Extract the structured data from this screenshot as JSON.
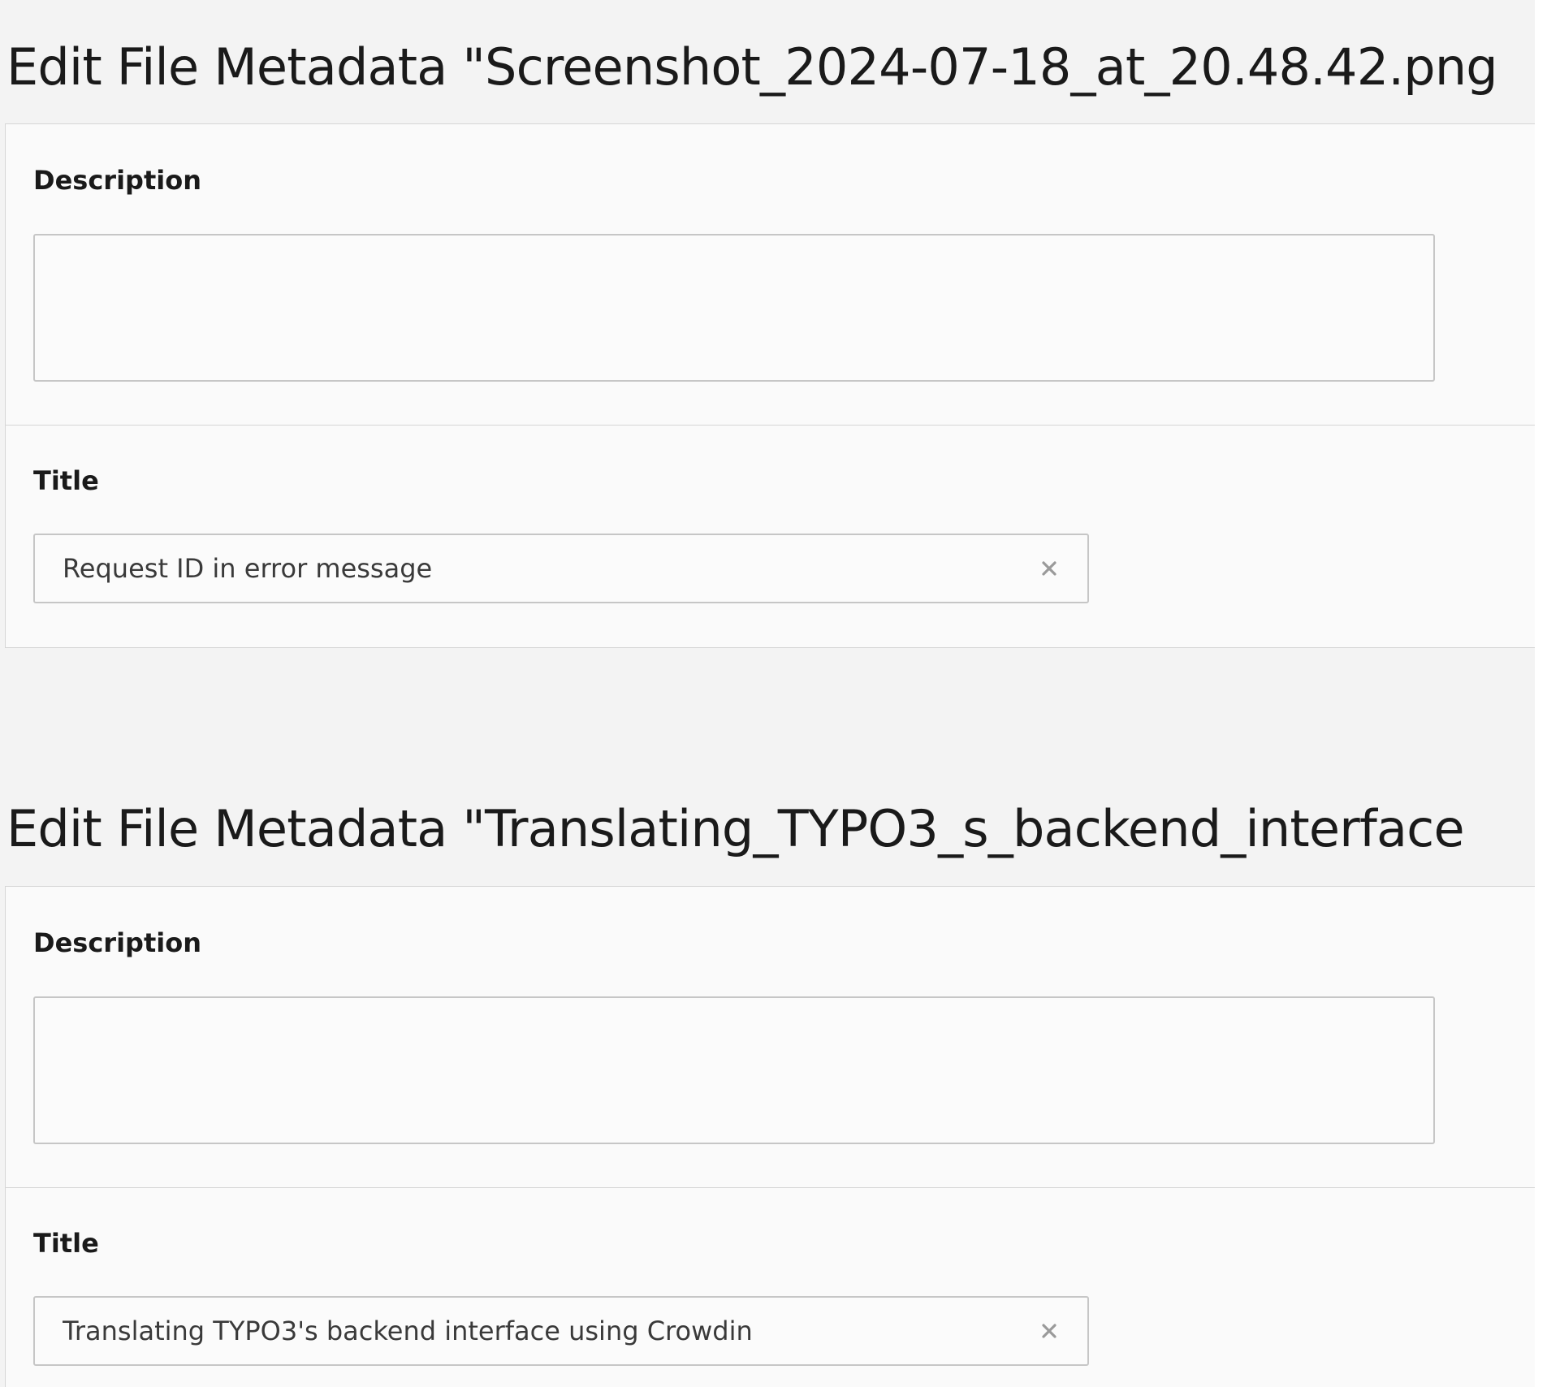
{
  "forms": [
    {
      "heading": "Edit File Metadata \"Screenshot_2024-07-18_at_20.48.42.png",
      "description": {
        "label": "Description",
        "value": ""
      },
      "title": {
        "label": "Title",
        "value": "Request ID in error message"
      }
    },
    {
      "heading": "Edit File Metadata \"Translating_TYPO3_s_backend_interface",
      "description": {
        "label": "Description",
        "value": ""
      },
      "title": {
        "label": "Title",
        "value": "Translating TYPO3's backend interface using Crowdin"
      }
    }
  ],
  "icons": {
    "clear": "close-icon"
  },
  "colors": {
    "background": "#f3f3f3",
    "panel": "#fafafa",
    "border": "#d6d6d6",
    "input_border": "#c6c6c6",
    "text": "#1a1a1a",
    "clear_icon": "#9a9a9a"
  }
}
